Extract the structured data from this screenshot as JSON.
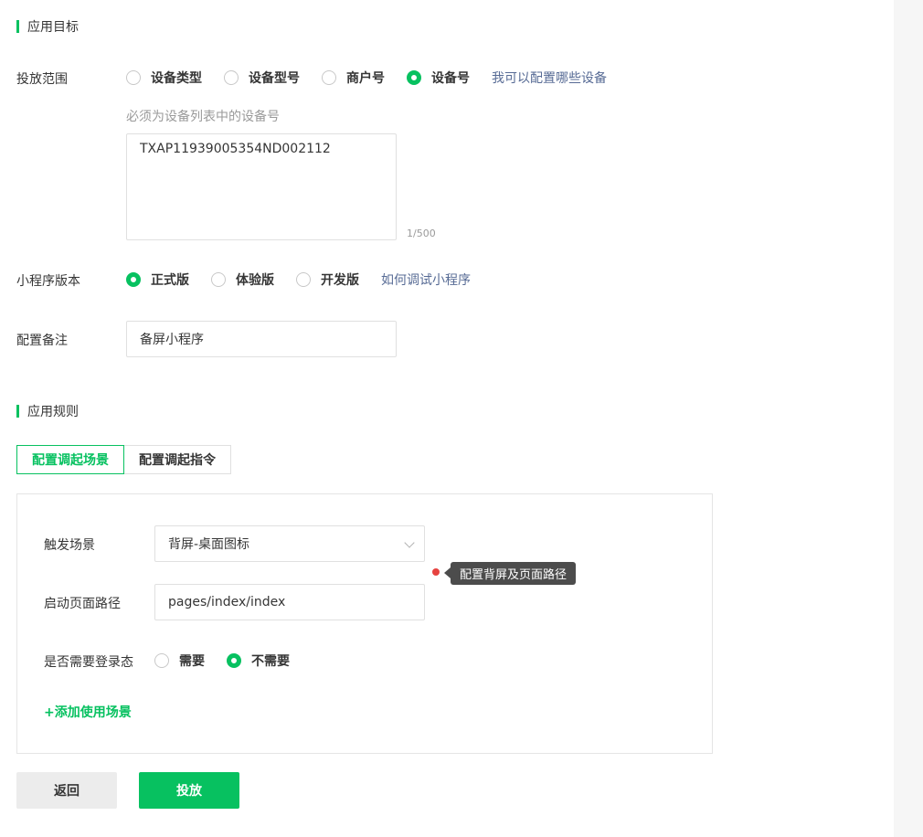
{
  "sections": {
    "target_title": "应用目标",
    "rules_title": "应用规则"
  },
  "scope": {
    "label": "投放范围",
    "options": [
      "设备类型",
      "设备型号",
      "商户号",
      "设备号"
    ],
    "selected": "设备号",
    "help_link": "我可以配置哪些设备",
    "hint": "必须为设备列表中的设备号",
    "device_value": "TXAP11939005354ND002112",
    "counter": "1/500"
  },
  "version": {
    "label": "小程序版本",
    "options": [
      "正式版",
      "体验版",
      "开发版"
    ],
    "selected": "正式版",
    "help_link": "如何调试小程序"
  },
  "remark": {
    "label": "配置备注",
    "value": "备屏小程序"
  },
  "tabs": {
    "scene": "配置调起场景",
    "command": "配置调起指令",
    "active": "配置调起场景"
  },
  "scene": {
    "trigger_label": "触发场景",
    "trigger_value": "背屏-桌面图标",
    "path_label": "启动页面路径",
    "path_value": "pages/index/index",
    "login_label": "是否需要登录态",
    "login_options": [
      "需要",
      "不需要"
    ],
    "login_selected": "不需要",
    "tooltip": "配置背屏及页面路径",
    "add_link": "+添加使用场景"
  },
  "actions": {
    "back": "返回",
    "submit": "投放"
  },
  "colors": {
    "accent": "#07c160",
    "link": "#576b95",
    "tooltip_dot": "#e64340"
  }
}
